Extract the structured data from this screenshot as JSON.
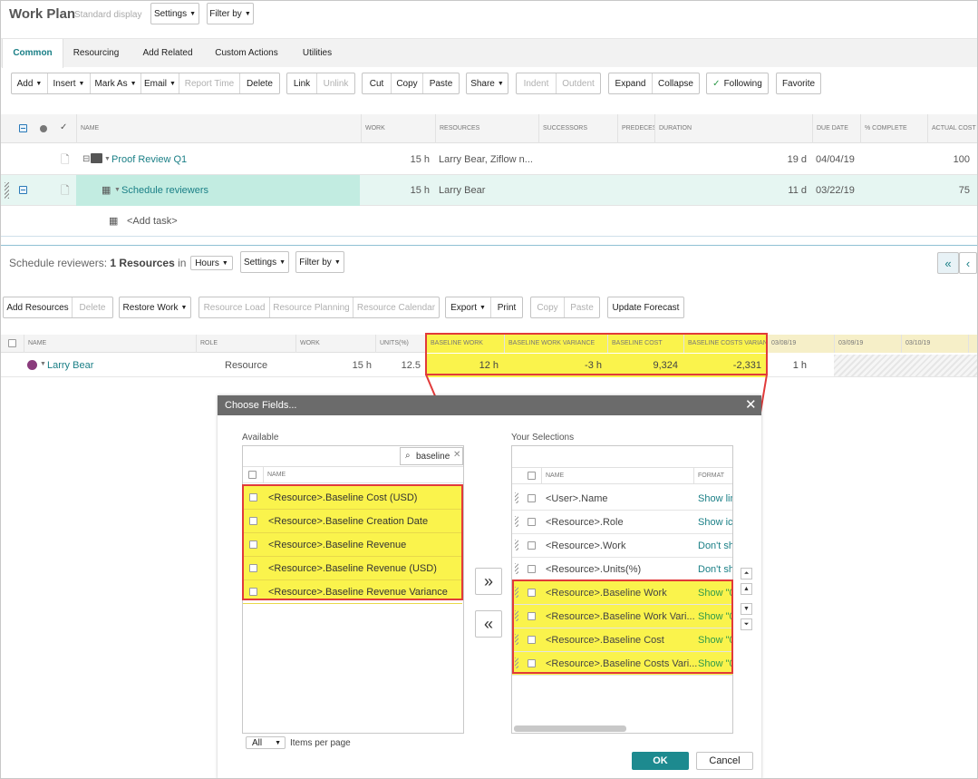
{
  "header": {
    "title": "Work Plan",
    "subtitle": "Standard display",
    "settings": "Settings",
    "filter": "Filter by"
  },
  "tabs": [
    "Common",
    "Resourcing",
    "Add Related",
    "Custom Actions",
    "Utilities"
  ],
  "toolbar": {
    "add": "Add",
    "insert": "Insert",
    "mark_as": "Mark As",
    "email": "Email",
    "report_time": "Report Time",
    "delete": "Delete",
    "link": "Link",
    "unlink": "Unlink",
    "cut": "Cut",
    "copy": "Copy",
    "paste": "Paste",
    "share": "Share",
    "indent": "Indent",
    "outdent": "Outdent",
    "expand": "Expand",
    "collapse": "Collapse",
    "following": "Following",
    "favorite": "Favorite"
  },
  "grid": {
    "columns": [
      "NAME",
      "WORK",
      "RESOURCES",
      "SUCCESSORS",
      "PREDECES",
      "DURATION",
      "DUE DATE",
      "% COMPLETE",
      "ACTUAL COST"
    ],
    "rows": [
      {
        "name": "Proof Review Q1",
        "work": "15 h",
        "resources": "Larry Bear, Ziflow n...",
        "duration": "19 d",
        "due": "04/04/19",
        "cost": "100"
      },
      {
        "name": "Schedule reviewers",
        "work": "15 h",
        "resources": "Larry Bear",
        "duration": "11 d",
        "due": "03/22/19",
        "cost": "75"
      }
    ],
    "add_task": "<Add task>"
  },
  "resources": {
    "caption_prefix": "Schedule reviewers:",
    "caption_bold": "1 Resources",
    "caption_in": "in",
    "unit": "Hours",
    "settings": "Settings",
    "filter": "Filter by",
    "toolbar": {
      "add_resources": "Add Resources",
      "delete": "Delete",
      "restore_work": "Restore Work",
      "resource_load": "Resource Load",
      "resource_planning": "Resource Planning",
      "resource_calendar": "Resource Calendar",
      "export": "Export",
      "print": "Print",
      "copy": "Copy",
      "paste": "Paste",
      "update_forecast": "Update Forecast"
    },
    "columns": [
      "NAME",
      "ROLE",
      "WORK",
      "UNITS(%)",
      "BASELINE WORK",
      "BASELINE WORK VARIANCE",
      "BASELINE COST",
      "BASELINE COSTS VARIANCE",
      "03/08/19",
      "03/09/19",
      "03/10/19"
    ],
    "row": {
      "name": "Larry Bear",
      "role": "Resource",
      "work": "15 h",
      "units": "12.5",
      "baseline_work": "12 h",
      "bw_variance": "-3 h",
      "baseline_cost": "9,324",
      "bc_variance": "-2,331",
      "day1": "1 h"
    }
  },
  "dialog": {
    "title": "Choose Fields...",
    "available": "Available",
    "search": "baseline",
    "name_col": "NAME",
    "format_col": "FORMAT",
    "available_items": [
      "<Resource>.Baseline Cost (USD)",
      "<Resource>.Baseline Creation Date",
      "<Resource>.Baseline Revenue",
      "<Resource>.Baseline Revenue (USD)",
      "<Resource>.Baseline Revenue Variance"
    ],
    "selections_label": "Your Selections",
    "selections": [
      {
        "name": "<User>.Name",
        "format": "Show lin"
      },
      {
        "name": "<Resource>.Role",
        "format": "Show ico"
      },
      {
        "name": "<Resource>.Work",
        "format": "Don't sh"
      },
      {
        "name": "<Resource>.Units(%)",
        "format": "Don't sh"
      },
      {
        "name": "<Resource>.Baseline Work",
        "format": "Show \"0"
      },
      {
        "name": "<Resource>.Baseline Work Vari...",
        "format": "Show \"0"
      },
      {
        "name": "<Resource>.Baseline Cost",
        "format": "Show \"0"
      },
      {
        "name": "<Resource>.Baseline Costs Vari...",
        "format": "Show \"0"
      }
    ],
    "page_size": "All",
    "items_per_page": "Items per page",
    "ok": "OK",
    "cancel": "Cancel"
  },
  "colors": {
    "teal": "#1a7f86",
    "highlight": "#faf34c",
    "callout": "#e13a3a",
    "ok": "#1d8a8f"
  }
}
